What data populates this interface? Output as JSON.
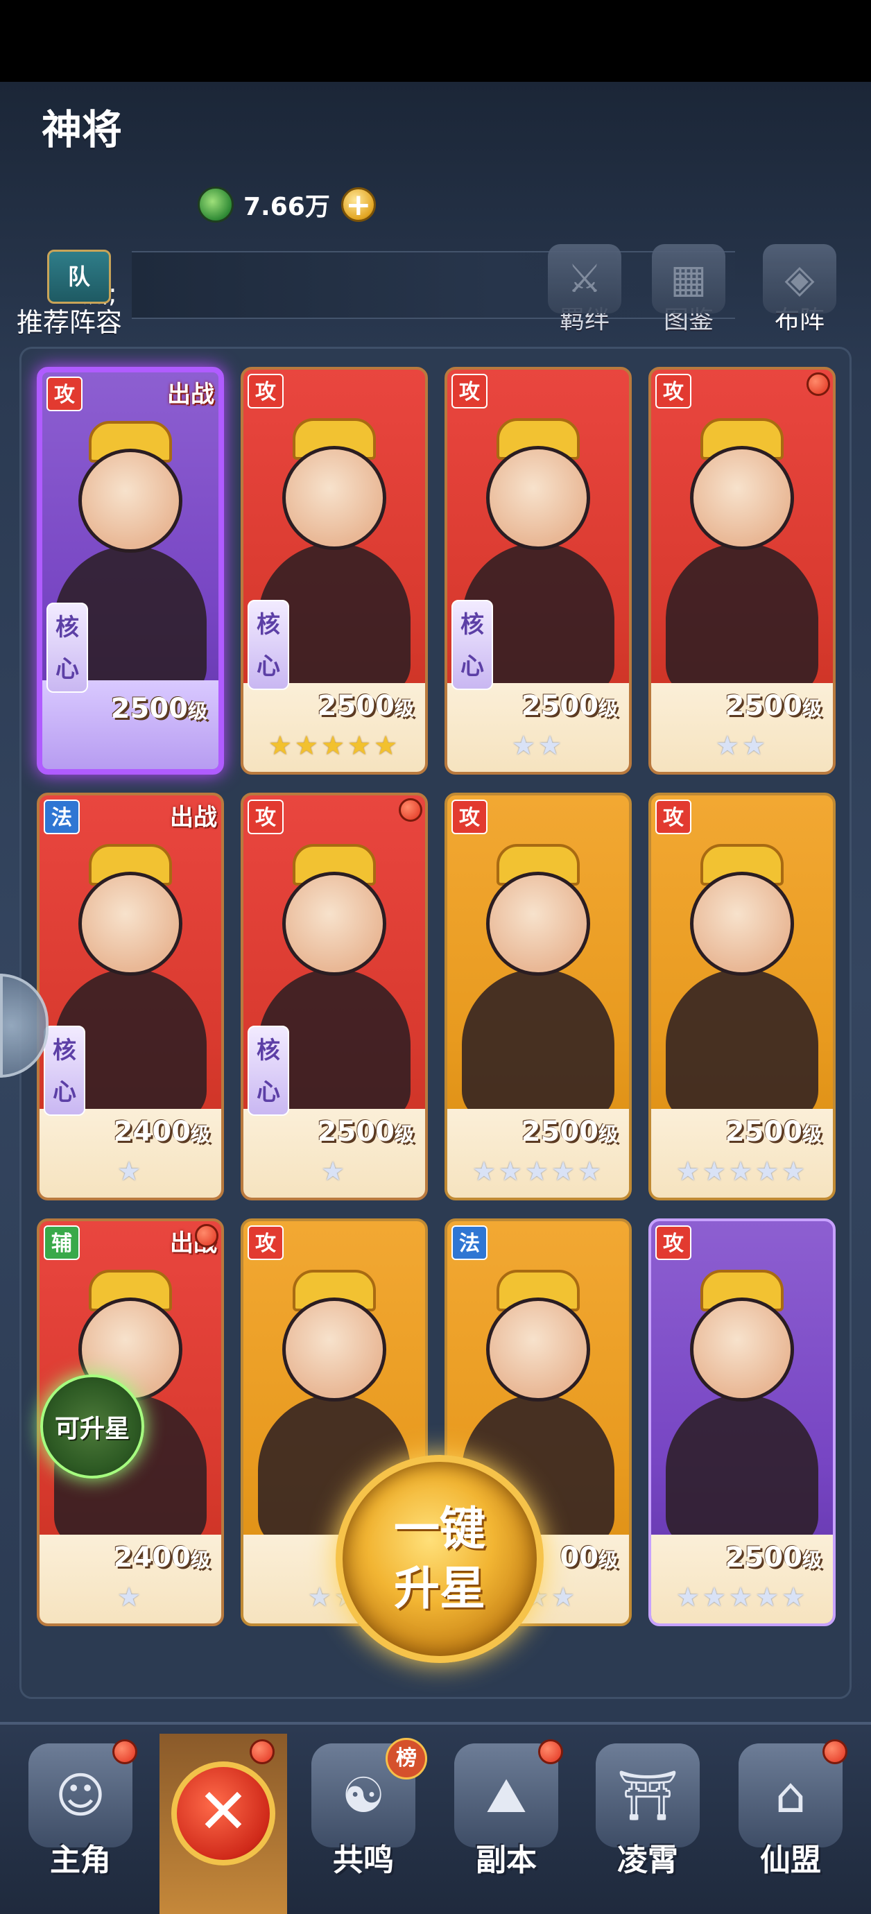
{
  "header": {
    "title": "神将",
    "currency_amount": "7.66万",
    "currency_plus": "+",
    "team_text": "洲;",
    "team_badge": "队",
    "recommend_label": "推荐阵容"
  },
  "tools": [
    {
      "label": "羁绊",
      "icon": "bond-icon"
    },
    {
      "label": "图鉴",
      "icon": "codex-icon"
    },
    {
      "label": "布阵",
      "icon": "formation-icon"
    }
  ],
  "cards": [
    {
      "level": "2500",
      "unit": "级",
      "stars": "",
      "star_color": "gold",
      "deploy": "出战",
      "core": "核心",
      "type": "攻",
      "color": "purple"
    },
    {
      "level": "2500",
      "unit": "级",
      "stars": "★★★★★",
      "star_color": "gold",
      "deploy": "",
      "core": "核心",
      "type": "攻",
      "color": "red"
    },
    {
      "level": "2500",
      "unit": "级",
      "stars": "★★",
      "star_color": "silver",
      "deploy": "",
      "core": "核心",
      "type": "攻",
      "color": "red"
    },
    {
      "level": "2500",
      "unit": "级",
      "stars": "★★",
      "star_color": "silver",
      "deploy": "",
      "core": "",
      "type": "攻",
      "color": "red"
    },
    {
      "level": "2400",
      "unit": "级",
      "stars": "★",
      "star_color": "silver",
      "deploy": "出战",
      "core": "核心",
      "type": "法",
      "color": "red"
    },
    {
      "level": "2500",
      "unit": "级",
      "stars": "★",
      "star_color": "silver",
      "deploy": "",
      "core": "核心",
      "type": "攻",
      "color": "red"
    },
    {
      "level": "2500",
      "unit": "级",
      "stars": "★★★★★",
      "star_color": "silver",
      "deploy": "",
      "core": "",
      "type": "攻",
      "color": "gold"
    },
    {
      "level": "2500",
      "unit": "级",
      "stars": "★★★★★",
      "star_color": "silver",
      "deploy": "",
      "core": "",
      "type": "攻",
      "color": "gold"
    },
    {
      "level": "2400",
      "unit": "级",
      "stars": "★",
      "star_color": "silver",
      "deploy": "出战",
      "core": "",
      "type": "辅",
      "color": "red"
    },
    {
      "level": "",
      "unit": "",
      "stars": "★★",
      "star_color": "silver",
      "deploy": "",
      "core": "",
      "type": "攻",
      "color": "gold"
    },
    {
      "level": "00",
      "unit": "级",
      "stars": "★★★",
      "star_color": "silver",
      "deploy": "",
      "core": "",
      "type": "法",
      "color": "gold"
    },
    {
      "level": "2500",
      "unit": "级",
      "stars": "★★★★★",
      "star_color": "silver",
      "deploy": "",
      "core": "",
      "type": "攻",
      "color": "purple"
    }
  ],
  "upstar_bubble": "可升星",
  "one_key_button": {
    "line1": "一键",
    "line2": "升星"
  },
  "nav": [
    {
      "label": "主角",
      "icon": "hero-icon"
    },
    {
      "label": "",
      "icon": "close-icon",
      "close": "✕"
    },
    {
      "label": "共鸣",
      "icon": "resonance-icon",
      "badge": "榜"
    },
    {
      "label": "副本",
      "icon": "dungeon-icon"
    },
    {
      "label": "凌霄",
      "icon": "palace-icon"
    },
    {
      "label": "仙盟",
      "icon": "guild-icon"
    }
  ]
}
